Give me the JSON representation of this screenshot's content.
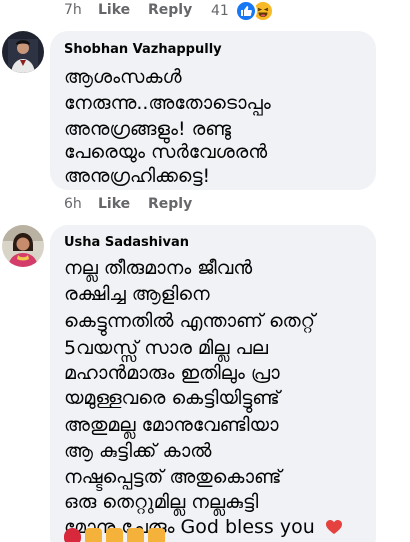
{
  "top_actions": {
    "time": "7h",
    "like_label": "Like",
    "reply_label": "Reply",
    "reaction_count": "41",
    "reaction_icons": [
      "like-icon",
      "haha-icon"
    ]
  },
  "comments": [
    {
      "author": "Shobhan Vazhappully",
      "lines": [
        "ആശംസകൾ",
        "നേരുന്നു..അതോടൊപ്പം",
        "അനുഗ്രങ്ങളും! രണ്ടു",
        "പേരെയും സർവേശരൻ",
        "അനുഗ്രഹിക്കട്ടെ!"
      ],
      "time": "6h",
      "like_label": "Like",
      "reply_label": "Reply"
    },
    {
      "author": "Usha Sadashivan",
      "lines": [
        "നല്ല തീരുമാനം ജീവൻ",
        "രക്ഷിച്ച ആളിനെ",
        "കെട്ടുന്നതിൽ എന്താണ് തെറ്റ്",
        "5വയസ്സ് സാര മില്ല പല",
        "മഹാൻമാരും ഇതിലും പ്രാ",
        "യമുള്ളവരെ കെട്ടിയിട്ടുണ്ട്",
        "അതുമല്ല മോനുവേണ്ടിയാ",
        "ആ കുട്ടിക്ക് കാൽ",
        "നഷ്ടപ്പെട്ടത് അതുകൊണ്ട്",
        "ഒരു തെറ്റുമില്ല നല്ലകുട്ടി",
        "മോനു ചേരും God bless you"
      ],
      "trailing_emoji": "heart-emoji",
      "emoji_row": [
        "rose-emoji",
        "folded-hands-emoji",
        "folded-hands-emoji",
        "folded-hands-emoji",
        "folded-hands-emoji"
      ]
    }
  ],
  "colors": {
    "bubble": "#f0f2f5",
    "secondary_text": "#65676b",
    "like_blue": "#1877f2",
    "haha_yellow": "#f7b928",
    "heart_red": "#e4413f"
  }
}
